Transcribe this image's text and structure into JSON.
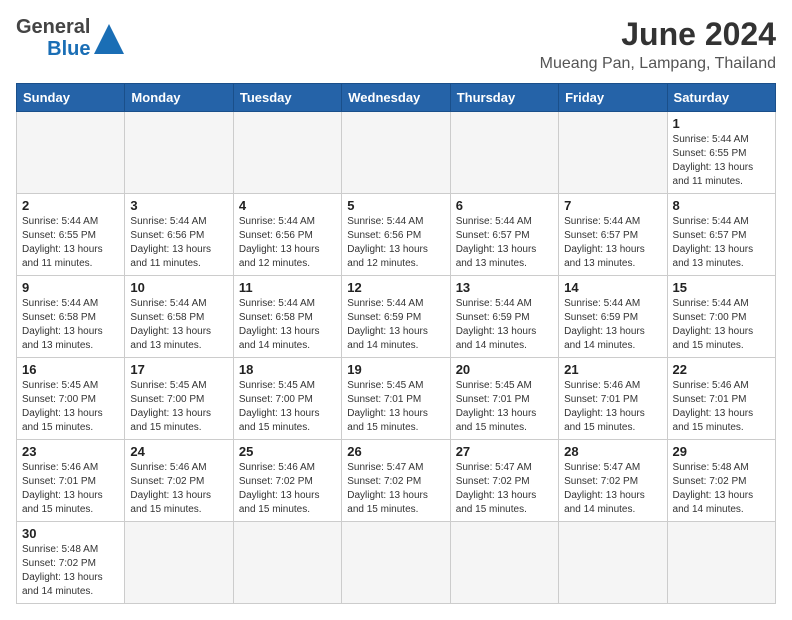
{
  "header": {
    "logo_general": "General",
    "logo_blue": "Blue",
    "title": "June 2024",
    "subtitle": "Mueang Pan, Lampang, Thailand"
  },
  "weekdays": [
    "Sunday",
    "Monday",
    "Tuesday",
    "Wednesday",
    "Thursday",
    "Friday",
    "Saturday"
  ],
  "weeks": [
    [
      {
        "day": "",
        "info": ""
      },
      {
        "day": "",
        "info": ""
      },
      {
        "day": "",
        "info": ""
      },
      {
        "day": "",
        "info": ""
      },
      {
        "day": "",
        "info": ""
      },
      {
        "day": "",
        "info": ""
      },
      {
        "day": "1",
        "info": "Sunrise: 5:44 AM\nSunset: 6:55 PM\nDaylight: 13 hours\nand 11 minutes."
      }
    ],
    [
      {
        "day": "2",
        "info": "Sunrise: 5:44 AM\nSunset: 6:55 PM\nDaylight: 13 hours\nand 11 minutes."
      },
      {
        "day": "3",
        "info": "Sunrise: 5:44 AM\nSunset: 6:56 PM\nDaylight: 13 hours\nand 11 minutes."
      },
      {
        "day": "4",
        "info": "Sunrise: 5:44 AM\nSunset: 6:56 PM\nDaylight: 13 hours\nand 12 minutes."
      },
      {
        "day": "5",
        "info": "Sunrise: 5:44 AM\nSunset: 6:56 PM\nDaylight: 13 hours\nand 12 minutes."
      },
      {
        "day": "6",
        "info": "Sunrise: 5:44 AM\nSunset: 6:57 PM\nDaylight: 13 hours\nand 13 minutes."
      },
      {
        "day": "7",
        "info": "Sunrise: 5:44 AM\nSunset: 6:57 PM\nDaylight: 13 hours\nand 13 minutes."
      },
      {
        "day": "8",
        "info": "Sunrise: 5:44 AM\nSunset: 6:57 PM\nDaylight: 13 hours\nand 13 minutes."
      }
    ],
    [
      {
        "day": "9",
        "info": "Sunrise: 5:44 AM\nSunset: 6:58 PM\nDaylight: 13 hours\nand 13 minutes."
      },
      {
        "day": "10",
        "info": "Sunrise: 5:44 AM\nSunset: 6:58 PM\nDaylight: 13 hours\nand 13 minutes."
      },
      {
        "day": "11",
        "info": "Sunrise: 5:44 AM\nSunset: 6:58 PM\nDaylight: 13 hours\nand 14 minutes."
      },
      {
        "day": "12",
        "info": "Sunrise: 5:44 AM\nSunset: 6:59 PM\nDaylight: 13 hours\nand 14 minutes."
      },
      {
        "day": "13",
        "info": "Sunrise: 5:44 AM\nSunset: 6:59 PM\nDaylight: 13 hours\nand 14 minutes."
      },
      {
        "day": "14",
        "info": "Sunrise: 5:44 AM\nSunset: 6:59 PM\nDaylight: 13 hours\nand 14 minutes."
      },
      {
        "day": "15",
        "info": "Sunrise: 5:44 AM\nSunset: 7:00 PM\nDaylight: 13 hours\nand 15 minutes."
      }
    ],
    [
      {
        "day": "16",
        "info": "Sunrise: 5:45 AM\nSunset: 7:00 PM\nDaylight: 13 hours\nand 15 minutes."
      },
      {
        "day": "17",
        "info": "Sunrise: 5:45 AM\nSunset: 7:00 PM\nDaylight: 13 hours\nand 15 minutes."
      },
      {
        "day": "18",
        "info": "Sunrise: 5:45 AM\nSunset: 7:00 PM\nDaylight: 13 hours\nand 15 minutes."
      },
      {
        "day": "19",
        "info": "Sunrise: 5:45 AM\nSunset: 7:01 PM\nDaylight: 13 hours\nand 15 minutes."
      },
      {
        "day": "20",
        "info": "Sunrise: 5:45 AM\nSunset: 7:01 PM\nDaylight: 13 hours\nand 15 minutes."
      },
      {
        "day": "21",
        "info": "Sunrise: 5:46 AM\nSunset: 7:01 PM\nDaylight: 13 hours\nand 15 minutes."
      },
      {
        "day": "22",
        "info": "Sunrise: 5:46 AM\nSunset: 7:01 PM\nDaylight: 13 hours\nand 15 minutes."
      }
    ],
    [
      {
        "day": "23",
        "info": "Sunrise: 5:46 AM\nSunset: 7:01 PM\nDaylight: 13 hours\nand 15 minutes."
      },
      {
        "day": "24",
        "info": "Sunrise: 5:46 AM\nSunset: 7:02 PM\nDaylight: 13 hours\nand 15 minutes."
      },
      {
        "day": "25",
        "info": "Sunrise: 5:46 AM\nSunset: 7:02 PM\nDaylight: 13 hours\nand 15 minutes."
      },
      {
        "day": "26",
        "info": "Sunrise: 5:47 AM\nSunset: 7:02 PM\nDaylight: 13 hours\nand 15 minutes."
      },
      {
        "day": "27",
        "info": "Sunrise: 5:47 AM\nSunset: 7:02 PM\nDaylight: 13 hours\nand 15 minutes."
      },
      {
        "day": "28",
        "info": "Sunrise: 5:47 AM\nSunset: 7:02 PM\nDaylight: 13 hours\nand 14 minutes."
      },
      {
        "day": "29",
        "info": "Sunrise: 5:48 AM\nSunset: 7:02 PM\nDaylight: 13 hours\nand 14 minutes."
      }
    ],
    [
      {
        "day": "30",
        "info": "Sunrise: 5:48 AM\nSunset: 7:02 PM\nDaylight: 13 hours\nand 14 minutes."
      },
      {
        "day": "",
        "info": ""
      },
      {
        "day": "",
        "info": ""
      },
      {
        "day": "",
        "info": ""
      },
      {
        "day": "",
        "info": ""
      },
      {
        "day": "",
        "info": ""
      },
      {
        "day": "",
        "info": ""
      }
    ]
  ]
}
